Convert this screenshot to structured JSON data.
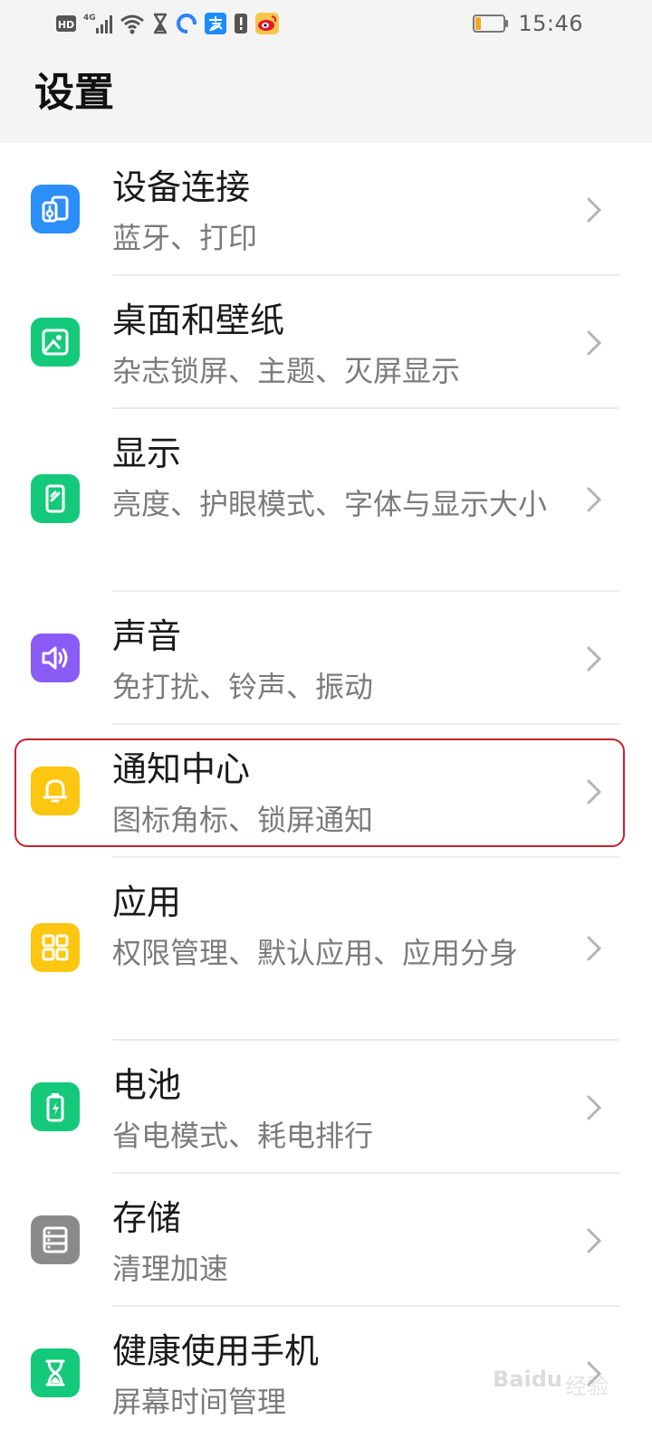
{
  "status_bar": {
    "network_hd": "HD",
    "network_gen": "4G",
    "time": "15:46",
    "icons": [
      "hd-icon",
      "signal-4g-icon",
      "wifi-icon",
      "hourglass-icon",
      "app-notification-icon",
      "alipay-icon",
      "alert-icon",
      "weibo-icon",
      "battery-icon"
    ],
    "battery_level": 0.2,
    "battery_color": "#f5a623"
  },
  "header": {
    "title": "设置"
  },
  "colors": {
    "blue": "#2c8ef8",
    "green": "#14c97a",
    "purple": "#8a5cf5",
    "yellow": "#fcc611",
    "gray": "#8a8a8a",
    "highlight": "#c9222b"
  },
  "items": [
    {
      "title": "设备连接",
      "subtitle": "蓝牙、打印",
      "icon": "device-connect-icon",
      "color": "#2c8ef8"
    },
    {
      "title": "桌面和壁纸",
      "subtitle": "杂志锁屏、主题、灭屏显示",
      "icon": "wallpaper-icon",
      "color": "#14c97a"
    },
    {
      "title": "显示",
      "subtitle": "亮度、护眼模式、字体与显示大小",
      "icon": "display-icon",
      "color": "#14c97a"
    },
    {
      "title": "声音",
      "subtitle": "免打扰、铃声、振动",
      "icon": "sound-icon",
      "color": "#8a5cf5"
    },
    {
      "title": "通知中心",
      "subtitle": "图标角标、锁屏通知",
      "icon": "bell-icon",
      "color": "#fcc611",
      "highlighted": true
    },
    {
      "title": "应用",
      "subtitle": "权限管理、默认应用、应用分身",
      "icon": "apps-icon",
      "color": "#fcc611"
    },
    {
      "title": "电池",
      "subtitle": "省电模式、耗电排行",
      "icon": "battery-icon",
      "color": "#14c97a"
    },
    {
      "title": "存储",
      "subtitle": "清理加速",
      "icon": "storage-icon",
      "color": "#8a8a8a"
    },
    {
      "title": "健康使用手机",
      "subtitle": "屏幕时间管理",
      "icon": "hourglass-icon",
      "color": "#14c97a"
    }
  ],
  "watermark": {
    "text": "Baidu",
    "sub": "经验"
  }
}
